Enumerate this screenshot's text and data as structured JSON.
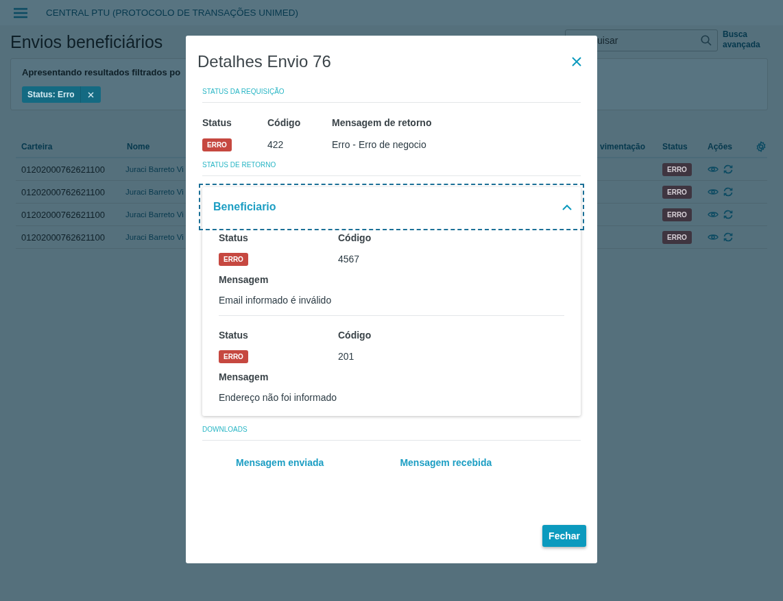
{
  "header": {
    "title": "CENTRAL PTU (PROTOCOLO DE TRANSAÇÕES UNIMED)"
  },
  "page_title": "Envios beneficiários",
  "search": {
    "placeholder": "uisar"
  },
  "advanced_search": "Busca avançada",
  "filter": {
    "text": "Apresentando resultados filtrados po",
    "chips": [
      {
        "label": "Status: Erro"
      }
    ]
  },
  "table": {
    "columns": [
      "Carteira",
      "Nome",
      "vimentação",
      "Status",
      "Ações"
    ],
    "rows": [
      {
        "carteira": "01202000762621100",
        "nome": "Juraci Barreto Vi",
        "status": {
          "label": "ERRO",
          "kind": "error"
        }
      },
      {
        "carteira": "01202000762621100",
        "nome": "Juraci Barreto Vi",
        "status": {
          "label": "ERRO",
          "kind": "error"
        }
      },
      {
        "carteira": "01202000762621100",
        "nome": "Juraci Barreto Vi",
        "status": {
          "label": "ERRO",
          "kind": "error"
        }
      },
      {
        "carteira": "01202000762621100",
        "nome": "Juraci Barreto Vi",
        "status": {
          "label": "ERRO",
          "kind": "error"
        }
      }
    ]
  },
  "modal": {
    "title": "Detalhes Envio 76",
    "request_status": {
      "heading": "STATUS DA REQUISIÇÃO",
      "labels": [
        "Status",
        "Código",
        "Mensagem de retorno"
      ],
      "status": {
        "label": "ERRO",
        "kind": "error"
      },
      "code": "422",
      "message": "Erro - Erro de negocio"
    },
    "return_status": {
      "heading": "STATUS DE RETORNO",
      "accordion": {
        "title": "Beneficiario",
        "expanded": true,
        "focused": true,
        "entries": [
          {
            "status_label": "Status",
            "code_label": "Código",
            "status": {
              "label": "ERRO",
              "kind": "error"
            },
            "code": "4567",
            "message_label": "Mensagem",
            "message": "Email informado é inválido"
          },
          {
            "status_label": "Status",
            "code_label": "Código",
            "status": {
              "label": "ERRO",
              "kind": "error"
            },
            "code": "201",
            "message_label": "Mensagem",
            "message": "Endereço não foi informado"
          }
        ]
      }
    },
    "downloads": {
      "heading": "DOWNLOADS",
      "links": [
        "Mensagem enviada",
        "Mensagem recebida"
      ]
    },
    "buttons": [
      "Fechar"
    ]
  }
}
